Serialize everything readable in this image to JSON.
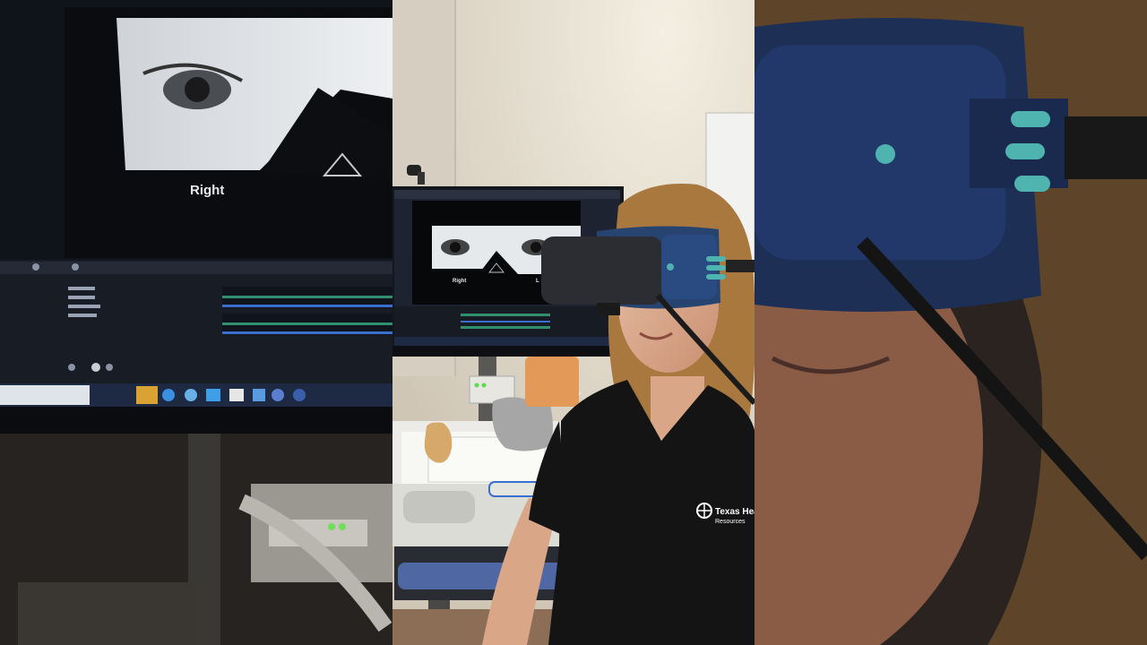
{
  "scene": {
    "monitor_left_label": "Right",
    "monitor_center_label_right": "Right",
    "monitor_center_label_left_partial": "L",
    "shirt_logo_line1": "Texas Healt",
    "shirt_logo_line2": "Resources"
  },
  "colors": {
    "wall": "#d9d2c4",
    "goggles": "#1f3a6e",
    "goggle_accent": "#4fb3b0",
    "shirt": "#141414",
    "hair": "#a8783f",
    "monitor_screen": "#1d2330"
  },
  "icons": [
    "webcam-icon",
    "eye-image",
    "goggles-icon",
    "ear-model-icon",
    "logo-icon"
  ]
}
